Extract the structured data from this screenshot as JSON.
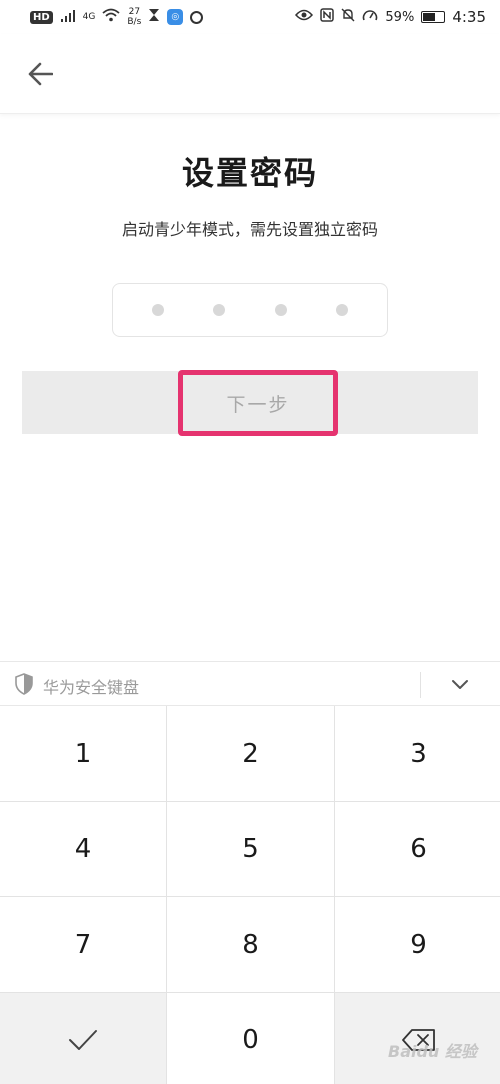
{
  "status_bar": {
    "hd_badge": "HD",
    "signal_label": "4G",
    "net_speed_value": "27",
    "net_speed_unit": "B/s",
    "battery": "59%",
    "battery_level": 0.59,
    "time": "4:35"
  },
  "page": {
    "title": "设置密码",
    "subtitle": "启动青少年模式，需先设置独立密码",
    "pin_length": 4,
    "next_label": "下一步",
    "highlight_color": "#e5336f"
  },
  "keyboard": {
    "label": "华为安全键盘",
    "keys": [
      "1",
      "2",
      "3",
      "4",
      "5",
      "6",
      "7",
      "8",
      "9",
      "0"
    ]
  },
  "watermark": "Baidu 经验"
}
